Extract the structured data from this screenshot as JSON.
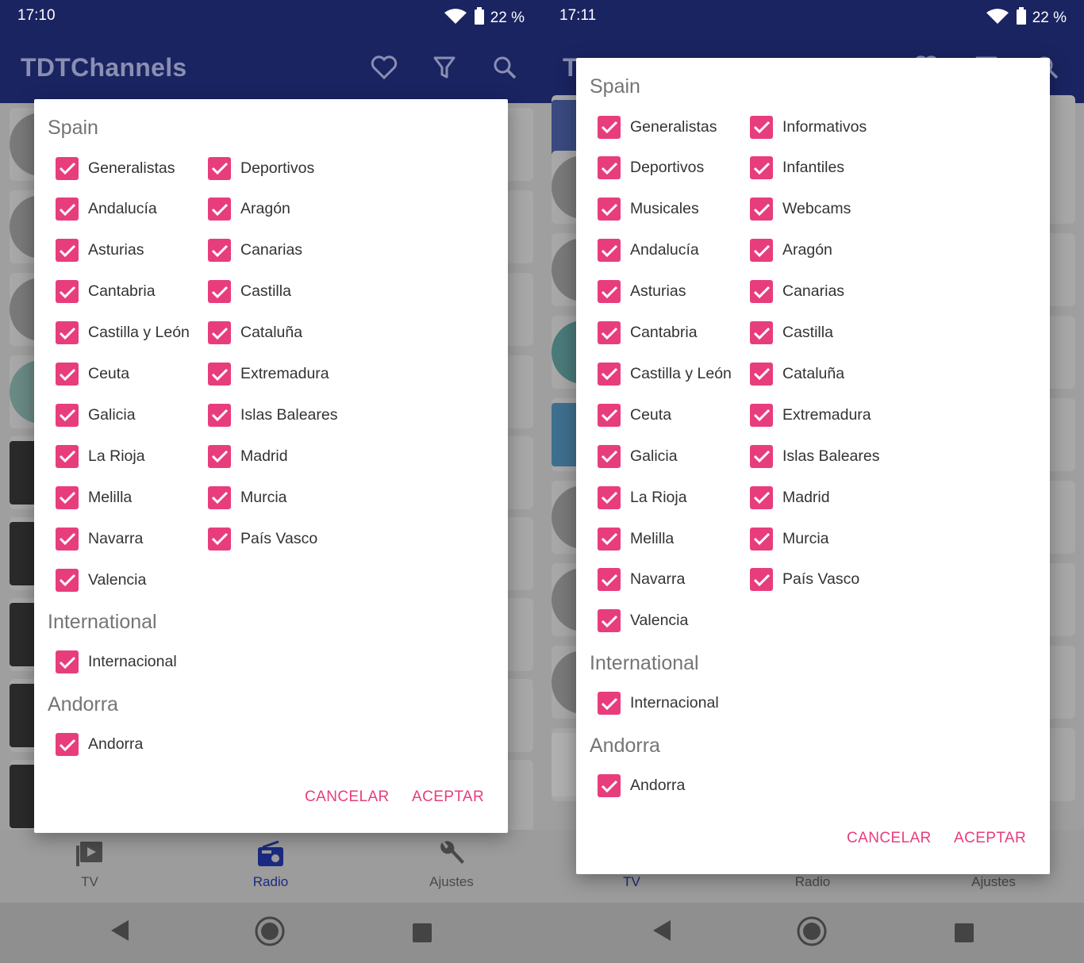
{
  "screens": [
    {
      "status": {
        "time": "17:10",
        "battery": "22 %"
      },
      "app_title": "TDTChannels",
      "nav": [
        {
          "label": "TV",
          "icon": "tv-icon",
          "active": false
        },
        {
          "label": "Radio",
          "icon": "radio-icon",
          "active": true
        },
        {
          "label": "Ajustes",
          "icon": "wrench-icon",
          "active": false
        }
      ],
      "dialog": {
        "sections": [
          {
            "title": "Spain",
            "items": [
              "Generalistas",
              "Deportivos",
              "Andalucía",
              "Aragón",
              "Asturias",
              "Canarias",
              "Cantabria",
              "Castilla",
              "Castilla y León",
              "Cataluña",
              "Ceuta",
              "Extremadura",
              "Galicia",
              "Islas Baleares",
              "La Rioja",
              "Madrid",
              "Melilla",
              "Murcia",
              "Navarra",
              "País Vasco",
              "Valencia"
            ]
          },
          {
            "title": "International",
            "items": [
              "Internacional"
            ]
          },
          {
            "title": "Andorra",
            "items": [
              "Andorra"
            ]
          }
        ],
        "cancel": "CANCELAR",
        "accept": "ACEPTAR"
      }
    },
    {
      "status": {
        "time": "17:11",
        "battery": "22 %"
      },
      "app_title": "T",
      "nav": [
        {
          "label": "TV",
          "icon": "tv-icon",
          "active": true
        },
        {
          "label": "Radio",
          "icon": "radio-icon",
          "active": false
        },
        {
          "label": "Ajustes",
          "icon": "wrench-icon",
          "active": false
        }
      ],
      "dialog": {
        "sections": [
          {
            "title": "Spain",
            "items": [
              "Generalistas",
              "Informativos",
              "Deportivos",
              "Infantiles",
              "Musicales",
              "Webcams",
              "Andalucía",
              "Aragón",
              "Asturias",
              "Canarias",
              "Cantabria",
              "Castilla",
              "Castilla y León",
              "Cataluña",
              "Ceuta",
              "Extremadura",
              "Galicia",
              "Islas Baleares",
              "La Rioja",
              "Madrid",
              "Melilla",
              "Murcia",
              "Navarra",
              "País Vasco",
              "Valencia"
            ]
          },
          {
            "title": "International",
            "items": [
              "Internacional"
            ]
          },
          {
            "title": "Andorra",
            "items": [
              "Andorra"
            ]
          }
        ],
        "cancel": "CANCELAR",
        "accept": "ACEPTAR"
      }
    }
  ],
  "colors": {
    "app_bar": "#1a2461",
    "checkbox": "#e83d7d",
    "button_text": "#e83d7d",
    "section_title": "#757575"
  }
}
